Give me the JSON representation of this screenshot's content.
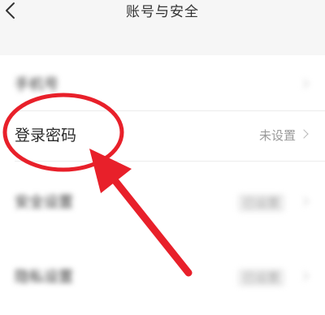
{
  "nav": {
    "title": "账号与安全"
  },
  "rows": [
    {
      "label": "手机号",
      "value": ""
    },
    {
      "label": "登录密码",
      "value": "未设置"
    },
    {
      "label": "安全设置",
      "value": "已设置"
    },
    {
      "label": "隐私设置",
      "value": "已设置"
    }
  ],
  "annotation": {
    "circle_color": "#e8202a",
    "arrow_color": "#e8202a"
  }
}
